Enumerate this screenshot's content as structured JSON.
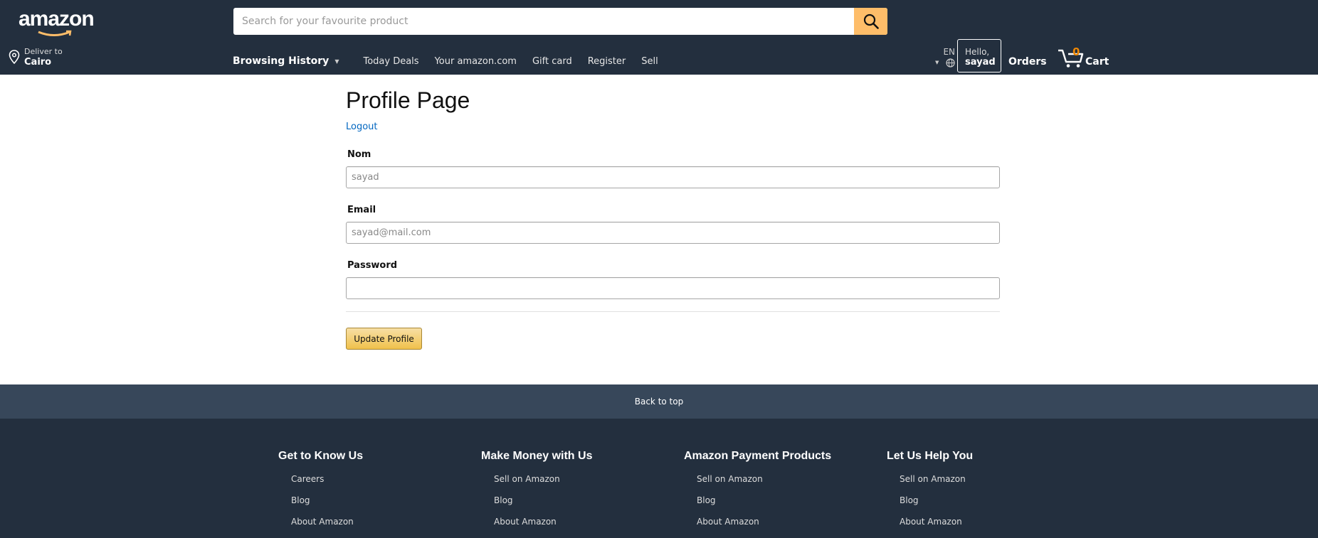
{
  "header": {
    "logo_text": "amazon",
    "search": {
      "placeholder": "Search for your favourite product",
      "value": ""
    },
    "deliver": {
      "line1": "Deliver to",
      "line2": "Cairo"
    },
    "nav": {
      "browsing_history": "Browsing History",
      "items": [
        "Today Deals",
        "Your amazon.com",
        "Gift card",
        "Register",
        "Sell"
      ]
    },
    "language": "EN",
    "account": {
      "greeting": "Hello,",
      "name": "sayad"
    },
    "orders": "Orders",
    "cart": {
      "count": "0",
      "label": "Cart"
    },
    "colors": {
      "bg": "#232f3e",
      "search_button": "#febd69",
      "cart_count": "#f08804"
    }
  },
  "main": {
    "title": "Profile Page",
    "logout": "Logout",
    "fields": [
      {
        "label": "Nom",
        "placeholder": "sayad",
        "value": ""
      },
      {
        "label": "Email",
        "placeholder": "sayad@mail.com",
        "value": ""
      },
      {
        "label": "Password",
        "placeholder": "",
        "value": ""
      }
    ],
    "submit": "Update Profile",
    "colors": {
      "link": "#0066c0",
      "button": "#f0c14b"
    }
  },
  "footer": {
    "back_to_top": "Back to top",
    "columns": [
      {
        "title": "Get to Know Us",
        "links": [
          "Careers",
          "Blog",
          "About Amazon"
        ]
      },
      {
        "title": "Make Money with Us",
        "links": [
          "Sell on Amazon",
          "Blog",
          "About Amazon"
        ]
      },
      {
        "title": "Amazon Payment Products",
        "links": [
          "Sell on Amazon",
          "Blog",
          "About Amazon"
        ]
      },
      {
        "title": "Let Us Help You",
        "links": [
          "Sell on Amazon",
          "Blog",
          "About Amazon"
        ]
      }
    ]
  }
}
